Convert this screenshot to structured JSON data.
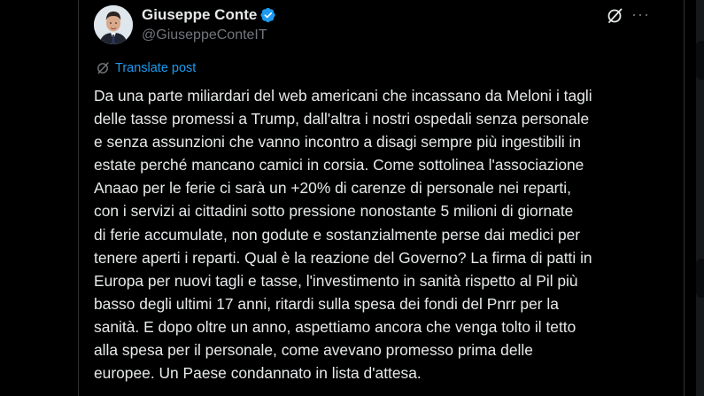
{
  "author": {
    "display_name": "Giuseppe Conte",
    "handle": "@GiuseppeConteIT",
    "verified": true
  },
  "actions": {
    "grok_icon": "grok-slash-circle-icon",
    "more_label": "···"
  },
  "translate": {
    "label": "Translate post"
  },
  "post": {
    "text": "Da una parte miliardari del web americani che incassano da Meloni i tagli\ndelle tasse promessi a Trump, dall'altra i nostri ospedali senza personale\ne senza assunzioni che vanno incontro a disagi sempre più ingestibili in\nestate perché mancano camici in corsia. Come sottolinea l'associazione\nAnaao per le ferie ci sarà un +20% di carenze di personale nei reparti,\ncon i servizi ai cittadini sotto pressione nonostante 5 milioni di giornate\ndi ferie accumulate, non godute e sostanzialmente perse dai medici per\ntenere aperti i reparti. Qual è la reazione del Governo? La firma di patti in\nEuropa per nuovi tagli e tasse, l'investimento in sanità rispetto al Pil più\nbasso degli ultimi 17 anni, ritardi sulla spesa dei fondi del Pnrr per la\nsanità. E dopo oltre un anno, aspettiamo ancora che venga tolto il tetto\nalla spesa per il personale, come avevano promesso prima delle\neuropee. Un Paese condannato in lista d'attesa."
  },
  "colors": {
    "background": "#000000",
    "text_primary": "#e7e9ea",
    "text_secondary": "#71767b",
    "accent": "#1d9bf0",
    "border": "#2f3336"
  }
}
